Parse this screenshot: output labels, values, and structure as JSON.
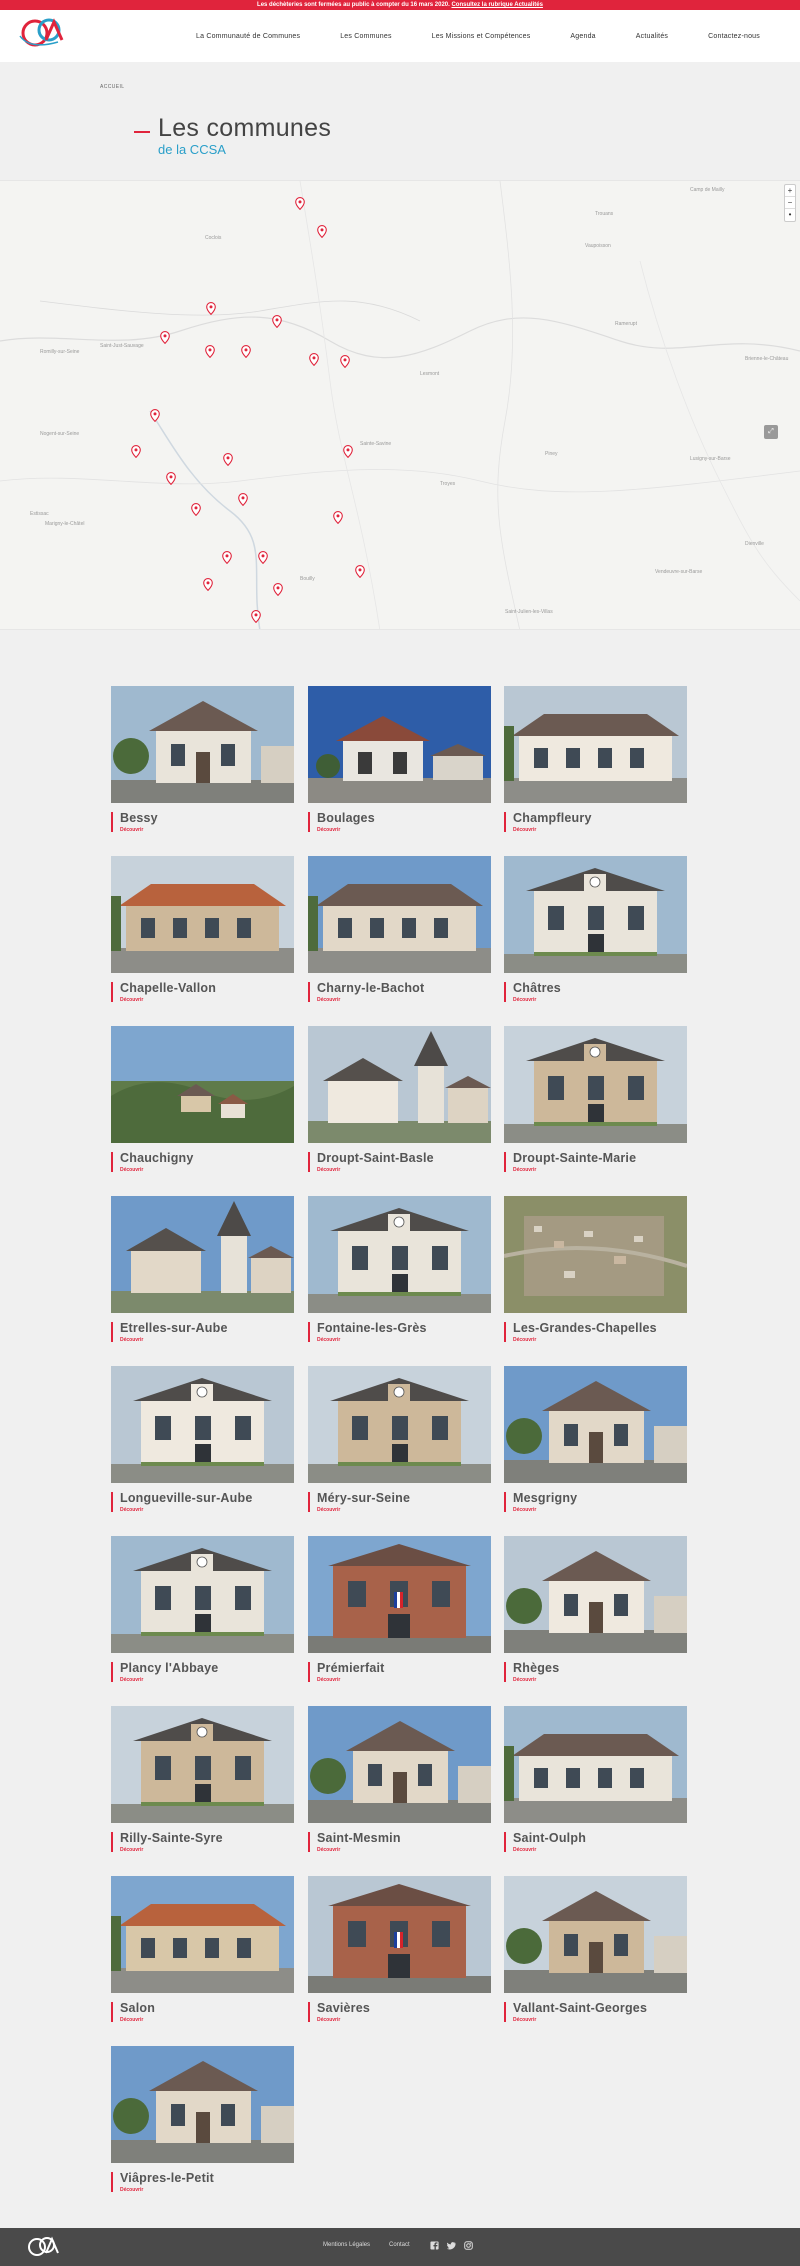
{
  "alert": {
    "text": "Les déchèteries sont fermées au public à compter du 16 mars 2020.",
    "link": "Consultez la rubrique Actualités"
  },
  "nav": {
    "items": [
      "La Communauté de Communes",
      "Les Communes",
      "Les Missions et Compétences",
      "Agenda",
      "Actualités",
      "Contactez-nous"
    ]
  },
  "breadcrumb": "ACCUEIL",
  "page": {
    "title": "Les communes",
    "subtitle": "de la CCSA"
  },
  "map": {
    "zoom_in": "+",
    "zoom_out": "−",
    "reset": "•",
    "labels": [
      "Camp de Mailly",
      "Coclois",
      "Trouans",
      "Vaupoisson",
      "Ramerupt",
      "Romilly-sur-Seine",
      "Saint-Just-Sauvage",
      "Nogent-sur-Seine",
      "Marigny-le-Châtel",
      "Piney",
      "Lusigny-sur-Barse",
      "Brienne-le-Château",
      "Troyes",
      "Sainte-Savine",
      "Estissac",
      "Bouilly",
      "Saint-Julien-les-Villas",
      "Vendeuvre-sur-Barse",
      "Lesmont",
      "Dienville"
    ]
  },
  "card_link": "Découvrir",
  "communes": [
    {
      "name": "Bessy",
      "photo": "house"
    },
    {
      "name": "Boulages",
      "photo": "sky"
    },
    {
      "name": "Champfleury",
      "photo": "long"
    },
    {
      "name": "Chapelle-Vallon",
      "photo": "long"
    },
    {
      "name": "Charny-le-Bachot",
      "photo": "long"
    },
    {
      "name": "Châtres",
      "photo": "mairie"
    },
    {
      "name": "Chauchigny",
      "photo": "village"
    },
    {
      "name": "Droupt-Saint-Basle",
      "photo": "church"
    },
    {
      "name": "Droupt-Sainte-Marie",
      "photo": "mairie"
    },
    {
      "name": "Etrelles-sur-Aube",
      "photo": "church"
    },
    {
      "name": "Fontaine-les-Grès",
      "photo": "mairie"
    },
    {
      "name": "Les-Grandes-Chapelles",
      "photo": "aerial"
    },
    {
      "name": "Longueville-sur-Aube",
      "photo": "mairie"
    },
    {
      "name": "Méry-sur-Seine",
      "photo": "mairie"
    },
    {
      "name": "Mesgrigny",
      "photo": "house"
    },
    {
      "name": "Plancy l'Abbaye",
      "photo": "mairie"
    },
    {
      "name": "Prémierfait",
      "photo": "brick"
    },
    {
      "name": "Rhèges",
      "photo": "house"
    },
    {
      "name": "Rilly-Sainte-Syre",
      "photo": "mairie"
    },
    {
      "name": "Saint-Mesmin",
      "photo": "house"
    },
    {
      "name": "Saint-Oulph",
      "photo": "long"
    },
    {
      "name": "Salon",
      "photo": "long"
    },
    {
      "name": "Savières",
      "photo": "brick"
    },
    {
      "name": "Vallant-Saint-Georges",
      "photo": "house"
    },
    {
      "name": "Viâpres-le-Petit",
      "photo": "house"
    }
  ],
  "footer": {
    "links": [
      "Mentions Légales",
      "Contact"
    ],
    "social": [
      "facebook-icon",
      "twitter-icon",
      "instagram-icon"
    ]
  },
  "colors": {
    "accent_red": "#e0243c",
    "accent_blue": "#2a9fc9",
    "footer_bg": "#4a4a4a"
  }
}
